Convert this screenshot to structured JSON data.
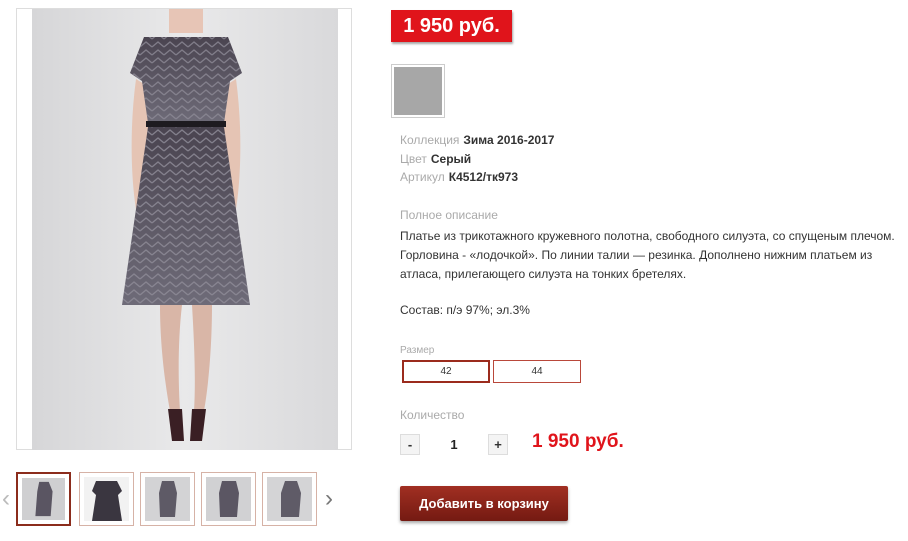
{
  "product": {
    "price_badge": "1 950 руб.",
    "color_swatch": "#a7a7a7",
    "attributes": [
      {
        "key": "Коллекция",
        "value": "Зима 2016-2017"
      },
      {
        "key": "Цвет",
        "value": "Серый"
      },
      {
        "key": "Артикул",
        "value": "К4512/тк973"
      }
    ],
    "description_heading": "Полное описание",
    "description": "Платье из трикотажного кружевного полотна, свободного силуэта, со спущеным плечом. Горловина - «лодочкой». По линии талии — резинка. Дополнено нижним платьем из атласа, прилегающего силуэта на тонких бретелях.",
    "composition": "Состав: п/э 97%; эл.3%",
    "size_heading": "Размер",
    "sizes": [
      "42",
      "44"
    ],
    "selected_size": "42",
    "quantity_heading": "Количество",
    "quantity": "1",
    "qty_minus": "-",
    "qty_plus": "+",
    "total": "1 950 руб.",
    "add_to_cart": "Добавить в корзину"
  },
  "gallery": {
    "prev_icon": "‹",
    "next_icon": "›",
    "thumb_count": 5,
    "active_thumb": 0
  },
  "colors": {
    "accent_red": "#e0141b",
    "button_dark_red": "#8b2c1c"
  }
}
